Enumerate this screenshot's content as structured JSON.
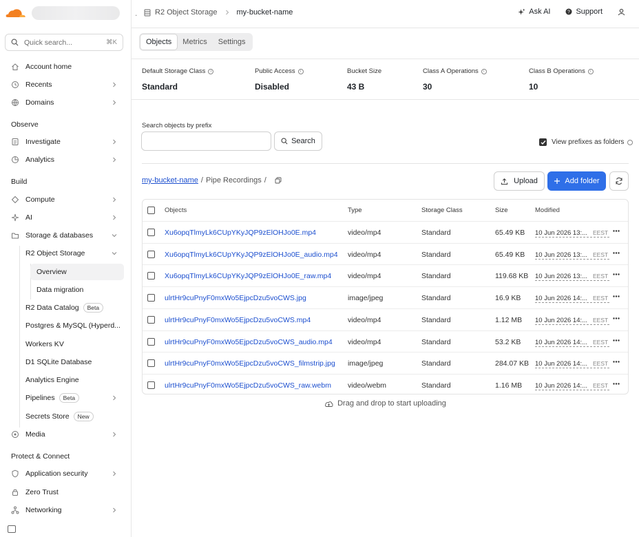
{
  "sidebar": {
    "quick_search": {
      "placeholder": "Quick search...",
      "shortcut": "⌘K"
    },
    "items": [
      {
        "label": "Account home",
        "icon": "home-icon"
      },
      {
        "label": "Recents",
        "icon": "clock-icon"
      },
      {
        "label": "Domains",
        "icon": "globe-icon"
      },
      {
        "label": "Investigate",
        "icon": "document-icon"
      },
      {
        "label": "Analytics",
        "icon": "chart-icon"
      },
      {
        "label": "Compute",
        "icon": "diamond-icon"
      },
      {
        "label": "AI",
        "icon": "sparkle-icon"
      },
      {
        "label": "Storage & databases",
        "icon": "folder-icon"
      },
      {
        "label": "R2 Object Storage"
      },
      {
        "label": "Overview"
      },
      {
        "label": "Data migration"
      },
      {
        "label": "R2 Data Catalog",
        "badge": "Beta"
      },
      {
        "label": "Postgres & MySQL (Hyperd..."
      },
      {
        "label": "Workers KV"
      },
      {
        "label": "D1 SQLite Database"
      },
      {
        "label": "Analytics Engine"
      },
      {
        "label": "Pipelines",
        "badge": "Beta"
      },
      {
        "label": "Secrets Store",
        "badge": "New"
      },
      {
        "label": "Media",
        "icon": "media-icon"
      },
      {
        "label": "Application security",
        "icon": "shield-icon"
      },
      {
        "label": "Zero Trust",
        "icon": "lock-icon"
      },
      {
        "label": "Networking",
        "icon": "network-icon"
      }
    ],
    "sections": {
      "observe": "Observe",
      "build": "Build",
      "protect": "Protect & Connect"
    }
  },
  "topbar": {
    "breadcrumb": {
      "service": "R2 Object Storage",
      "bucket": "my-bucket-name"
    },
    "ask_ai": "Ask AI",
    "support": "Support"
  },
  "tabs": [
    "Objects",
    "Metrics",
    "Settings"
  ],
  "stats": [
    {
      "label": "Default Storage Class",
      "value": "Standard",
      "info": true
    },
    {
      "label": "Public Access",
      "value": "Disabled",
      "info": true
    },
    {
      "label": "Bucket Size",
      "value": "43 B",
      "info": false
    },
    {
      "label": "Class A Operations",
      "value": "30",
      "info": true
    },
    {
      "label": "Class B Operations",
      "value": "10",
      "info": true
    }
  ],
  "search": {
    "label": "Search objects by prefix",
    "value": "",
    "button": "Search"
  },
  "view_prefixes": {
    "label": "View prefixes as folders",
    "checked": true
  },
  "path": {
    "root": "my-bucket-name",
    "folder": "Pipe Recordings"
  },
  "actions": {
    "upload": "Upload",
    "add_folder": "Add folder"
  },
  "table": {
    "headers": {
      "name": "Objects",
      "type": "Type",
      "class": "Storage Class",
      "size": "Size",
      "modified": "Modified"
    },
    "rows": [
      {
        "name": "Xu6opqTlmyLk6CUpYKyJQP9zElOHJo0E.mp4",
        "type": "video/mp4",
        "class": "Standard",
        "size": "65.49 KB",
        "date": "10 Jun 2026 13:...",
        "tz": "EEST"
      },
      {
        "name": "Xu6opqTlmyLk6CUpYKyJQP9zElOHJo0E_audio.mp4",
        "type": "video/mp4",
        "class": "Standard",
        "size": "65.49 KB",
        "date": "10 Jun 2026 13:...",
        "tz": "EEST"
      },
      {
        "name": "Xu6opqTlmyLk6CUpYKyJQP9zElOHJo0E_raw.mp4",
        "type": "video/mp4",
        "class": "Standard",
        "size": "119.68 KB",
        "date": "10 Jun 2026 13:...",
        "tz": "EEST"
      },
      {
        "name": "ulrtHr9cuPnyF0mxWo5EjpcDzu5voCWS.jpg",
        "type": "image/jpeg",
        "class": "Standard",
        "size": "16.9 KB",
        "date": "10 Jun 2026 14:...",
        "tz": "EEST"
      },
      {
        "name": "ulrtHr9cuPnyF0mxWo5EjpcDzu5voCWS.mp4",
        "type": "video/mp4",
        "class": "Standard",
        "size": "1.12 MB",
        "date": "10 Jun 2026 14:...",
        "tz": "EEST"
      },
      {
        "name": "ulrtHr9cuPnyF0mxWo5EjpcDzu5voCWS_audio.mp4",
        "type": "video/mp4",
        "class": "Standard",
        "size": "53.2 KB",
        "date": "10 Jun 2026 14:...",
        "tz": "EEST"
      },
      {
        "name": "ulrtHr9cuPnyF0mxWo5EjpcDzu5voCWS_filmstrip.jpg",
        "type": "image/jpeg",
        "class": "Standard",
        "size": "284.07 KB",
        "date": "10 Jun 2026 14:...",
        "tz": "EEST"
      },
      {
        "name": "ulrtHr9cuPnyF0mxWo5EjpcDzu5voCWS_raw.webm",
        "type": "video/webm",
        "class": "Standard",
        "size": "1.16 MB",
        "date": "10 Jun 2026 14:...",
        "tz": "EEST"
      }
    ]
  },
  "dropzone": "Drag and drop to start uploading",
  "colors": {
    "accent": "#2f6fe8",
    "link": "#1c4fcf",
    "brand": "#f38020"
  }
}
